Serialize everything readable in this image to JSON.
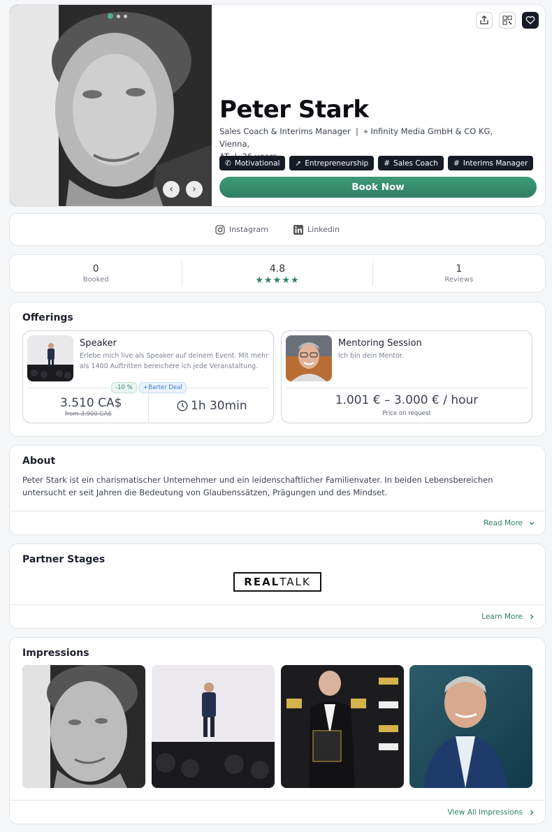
{
  "profile": {
    "name": "Peter Stark",
    "roles": "Sales Coach & Interims Manager",
    "company_location": "Infinity Media GmbH & CO KG, Vienna,",
    "country": "AT",
    "age": "26 years",
    "tags": [
      {
        "label": "Motivational",
        "icon": "megaphone-icon"
      },
      {
        "label": "Entrepreneurship",
        "icon": "rocket-icon"
      },
      {
        "label": "Sales Coach",
        "icon": "hash-icon"
      },
      {
        "label": "Interims Manager",
        "icon": "hash-icon"
      }
    ],
    "book_label": "Book Now"
  },
  "socials": [
    {
      "label": "Instagram",
      "icon": "instagram-icon"
    },
    {
      "label": "Linkedin",
      "icon": "linkedin-icon"
    }
  ],
  "stats": {
    "booked": {
      "value": "0",
      "label": "Booked"
    },
    "rating": {
      "value": "4.8",
      "stars": 5
    },
    "reviews": {
      "value": "1",
      "label": "Reviews"
    }
  },
  "offerings": {
    "title": "Offerings",
    "items": [
      {
        "title": "Speaker",
        "description": "Erlebe mich live als Speaker auf deinem Event. Mit mehr als 1400 Auftritten bereichere ich jede Veranstaltung.",
        "badge_discount": "-10 %",
        "badge_deal": "+Barter Deal",
        "price": "3.510 CA$",
        "price_original": "from 3.900 CA$",
        "duration": "1h 30min"
      },
      {
        "title": "Mentoring Session",
        "description": "Ich bin dein Mentor.",
        "price_range": "1.001 € – 3.000 € / hour",
        "price_note": "Price on request"
      }
    ]
  },
  "about": {
    "title": "About",
    "text": "Peter Stark ist ein charismatischer Unternehmer und ein leidenschaftlicher Familienvater. In beiden Lebensbereichen untersucht er seit Jahren die Bedeutung von Glaubenssätzen, Prägungen und des Mindset.",
    "read_more": "Read More"
  },
  "partner": {
    "title": "Partner Stages",
    "logo_bold": "REAL",
    "logo_light": "TALK",
    "learn_more": "Learn More"
  },
  "impressions": {
    "title": "Impressions",
    "view_all": "View All Impressions"
  },
  "colors": {
    "accent": "#2f7f62",
    "dark": "#161a24"
  }
}
